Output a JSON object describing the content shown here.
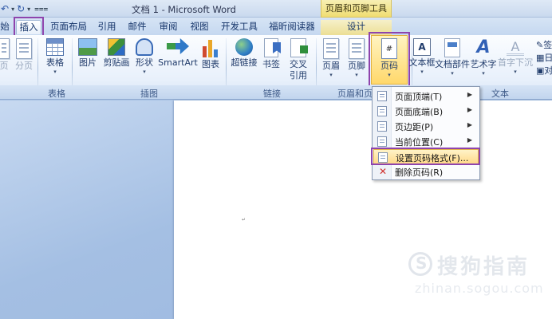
{
  "window": {
    "title": "文档 1 - Microsoft Word",
    "context_group": "页眉和页脚工具"
  },
  "tabs": [
    {
      "label": "始"
    },
    {
      "label": "插入",
      "active": true
    },
    {
      "label": "页面布局"
    },
    {
      "label": "引用"
    },
    {
      "label": "邮件"
    },
    {
      "label": "审阅"
    },
    {
      "label": "视图"
    },
    {
      "label": "开发工具"
    },
    {
      "label": "福昕阅读器"
    },
    {
      "label": "设计",
      "context": true
    }
  ],
  "ribbon": {
    "pages_group": {
      "label": "",
      "items": [
        {
          "label": "页"
        },
        {
          "label": "分页"
        }
      ]
    },
    "table_group": {
      "label": "表格",
      "items": [
        {
          "label": "表格",
          "icon": "table-icon"
        }
      ]
    },
    "illustrations_group": {
      "label": "插图",
      "items": [
        {
          "label": "图片",
          "icon": "picture-icon"
        },
        {
          "label": "剪贴画",
          "icon": "clipart-icon"
        },
        {
          "label": "形状",
          "icon": "shapes-icon"
        },
        {
          "label": "SmartArt",
          "icon": "smartart-icon"
        },
        {
          "label": "图表",
          "icon": "chart-icon"
        }
      ]
    },
    "links_group": {
      "label": "链接",
      "items": [
        {
          "label": "超链接",
          "icon": "hyperlink-icon"
        },
        {
          "label": "书签",
          "icon": "bookmark-icon"
        },
        {
          "label": "交叉",
          "label2": "引用",
          "icon": "cross-reference-icon"
        }
      ]
    },
    "header_footer_group": {
      "label": "页眉和页",
      "items": [
        {
          "label": "页眉",
          "icon": "header-icon"
        },
        {
          "label": "页脚",
          "icon": "footer-icon"
        },
        {
          "label": "页码",
          "icon": "page-number-icon",
          "glyph": "#"
        }
      ]
    },
    "text_group": {
      "label": "文本",
      "items": [
        {
          "label": "文本框",
          "icon": "textbox-icon",
          "glyph": "A"
        },
        {
          "label": "文档部件",
          "icon": "quick-parts-icon"
        },
        {
          "label": "艺术字",
          "icon": "wordart-icon",
          "glyph": "A"
        },
        {
          "label": "首字下沉",
          "icon": "dropcap-icon",
          "glyph": "A"
        }
      ]
    },
    "side_tools": [
      {
        "label": "签"
      },
      {
        "label": "日"
      },
      {
        "label": "对"
      }
    ]
  },
  "page_number_menu": {
    "items": [
      {
        "label": "页面顶端(T)",
        "submenu": true
      },
      {
        "label": "页面底端(B)",
        "submenu": true
      },
      {
        "label": "页边距(P)",
        "submenu": true
      },
      {
        "label": "当前位置(C)",
        "submenu": true
      },
      {
        "label": "设置页码格式(F)...",
        "submenu": false,
        "selected": true
      },
      {
        "label": "删除页码(R)",
        "submenu": false
      }
    ]
  },
  "watermark": {
    "text": "搜狗指南",
    "url": "zhinan.sogou.com"
  },
  "colors": {
    "highlight": "#8e44ad",
    "ribbon_bg": "#e8f0fb",
    "context_tab": "#f0dd72",
    "menu_selected": "#ffd98a"
  }
}
